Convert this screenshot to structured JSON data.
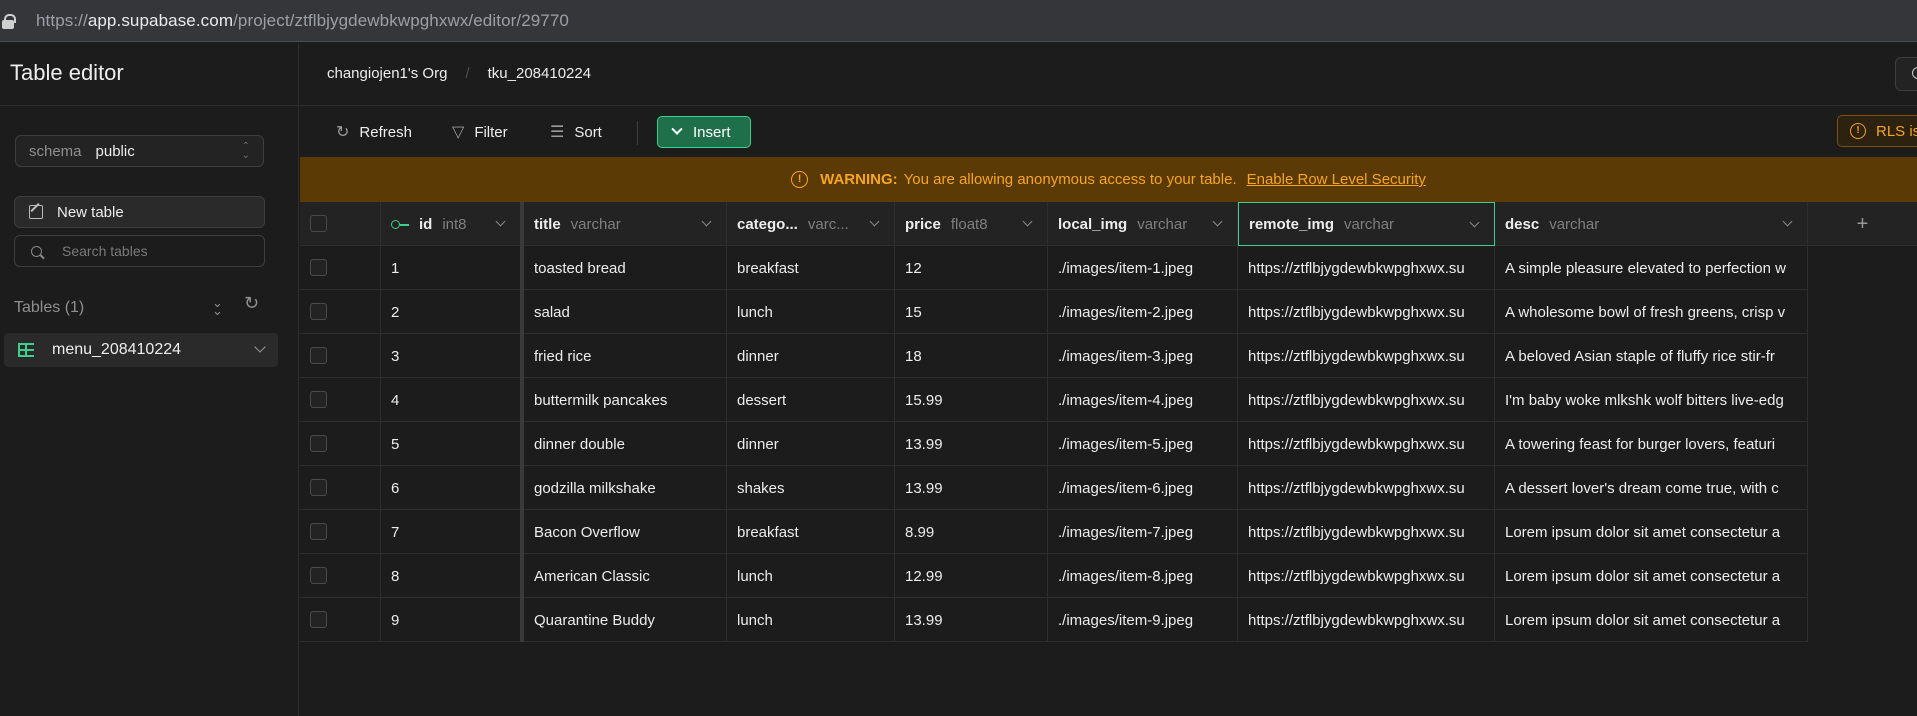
{
  "browser": {
    "url_prefix": "https://",
    "url_domain": "app.supabase.com",
    "url_path": "/project/ztflbjygdewbkwpghxwx/editor/29770"
  },
  "sidebar": {
    "title": "Table editor",
    "schema_label": "schema",
    "schema_value": "public",
    "new_table_label": "New table",
    "search_placeholder": "Search tables",
    "tables_heading": "Tables (1)",
    "tables": [
      {
        "name": "menu_208410224"
      }
    ]
  },
  "header": {
    "org": "changiojen1's Org",
    "project": "tku_208410224"
  },
  "toolbar": {
    "refresh_label": "Refresh",
    "filter_label": "Filter",
    "sort_label": "Sort",
    "insert_label": "Insert",
    "rls_label": "RLS is"
  },
  "warning": {
    "strong": "WARNING:",
    "text": "You are allowing anonymous access to your table.",
    "link": "Enable Row Level Security"
  },
  "grid": {
    "columns": [
      {
        "name": "id",
        "type": "int8"
      },
      {
        "name": "title",
        "type": "varchar"
      },
      {
        "name": "catego...",
        "type": "varc..."
      },
      {
        "name": "price",
        "type": "float8"
      },
      {
        "name": "local_img",
        "type": "varchar"
      },
      {
        "name": "remote_img",
        "type": "varchar"
      },
      {
        "name": "desc",
        "type": "varchar"
      }
    ],
    "add_column": "+",
    "rows": [
      [
        "1",
        "toasted bread",
        "breakfast",
        "12",
        "./images/item-1.jpeg",
        "https://ztflbjygdewbkwpghxwx.su",
        "A simple pleasure elevated to perfection w"
      ],
      [
        "2",
        "salad",
        "lunch",
        "15",
        "./images/item-2.jpeg",
        "https://ztflbjygdewbkwpghxwx.su",
        "A wholesome bowl of fresh greens, crisp v"
      ],
      [
        "3",
        "fried rice",
        "dinner",
        "18",
        "./images/item-3.jpeg",
        "https://ztflbjygdewbkwpghxwx.su",
        "A beloved Asian staple of fluffy rice stir-fr"
      ],
      [
        "4",
        "buttermilk pancakes",
        "dessert",
        "15.99",
        "./images/item-4.jpeg",
        "https://ztflbjygdewbkwpghxwx.su",
        "I'm baby woke mlkshk wolf bitters live-edg"
      ],
      [
        "5",
        "dinner double",
        "dinner",
        "13.99",
        "./images/item-5.jpeg",
        "https://ztflbjygdewbkwpghxwx.su",
        "A towering feast for burger lovers, featuri"
      ],
      [
        "6",
        "godzilla milkshake",
        "shakes",
        "13.99",
        "./images/item-6.jpeg",
        "https://ztflbjygdewbkwpghxwx.su",
        "A dessert lover's dream come true, with c"
      ],
      [
        "7",
        "Bacon Overflow",
        "breakfast",
        "8.99",
        "./images/item-7.jpeg",
        "https://ztflbjygdewbkwpghxwx.su",
        "Lorem ipsum dolor sit amet consectetur a"
      ],
      [
        "8",
        "American Classic",
        "lunch",
        "12.99",
        "./images/item-8.jpeg",
        "https://ztflbjygdewbkwpghxwx.su",
        "Lorem ipsum dolor sit amet consectetur a"
      ],
      [
        "9",
        "Quarantine Buddy",
        "lunch",
        "13.99",
        "./images/item-9.jpeg",
        "https://ztflbjygdewbkwpghxwx.su",
        "Lorem ipsum dolor sit amet consectetur a"
      ]
    ]
  },
  "colors": {
    "brand_green": "#3ecf8e",
    "warning_bg": "#5c3a06",
    "warning_text": "#f5a524",
    "background": "#1c1c1c"
  }
}
